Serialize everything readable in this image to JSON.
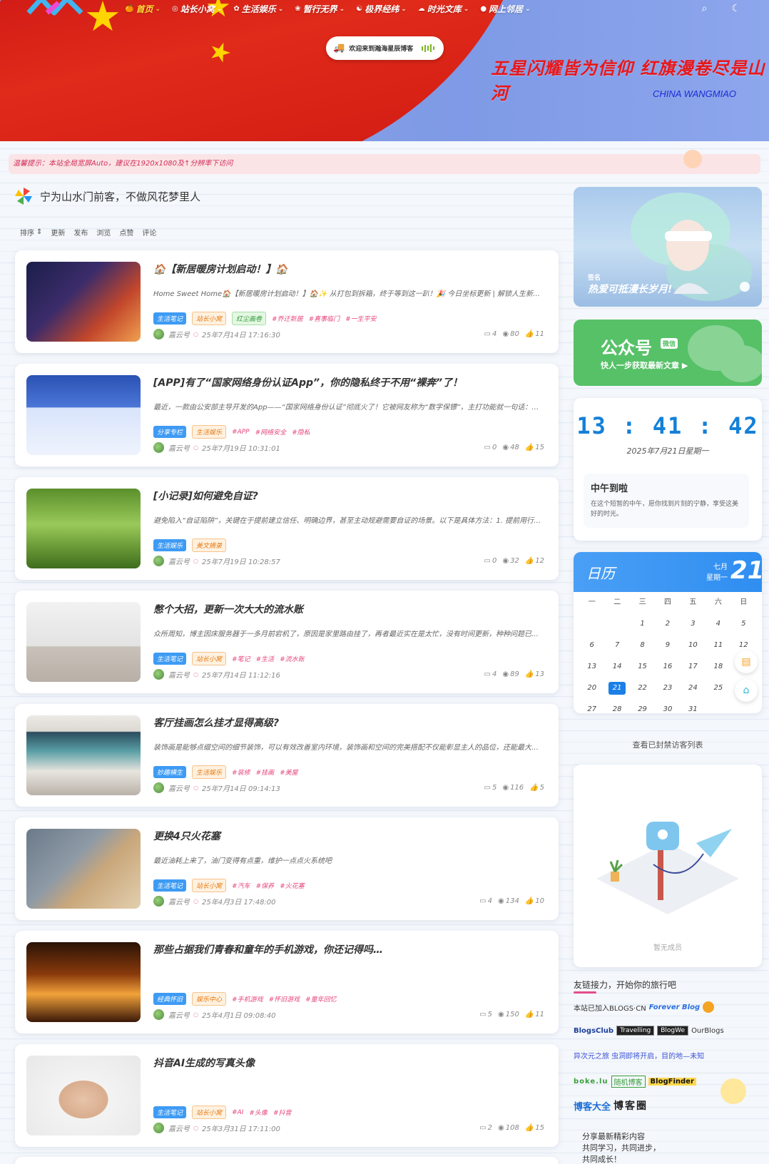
{
  "nav": {
    "items": [
      {
        "icon": "🍊",
        "label": "首页",
        "active": true
      },
      {
        "icon": "◎",
        "label": "站长小窝"
      },
      {
        "icon": "✿",
        "label": "生活娱乐"
      },
      {
        "icon": "❀",
        "label": "暂行无界"
      },
      {
        "icon": "☯",
        "label": "极界经纬"
      },
      {
        "icon": "☁",
        "label": "时光文库"
      },
      {
        "icon": "●",
        "label": "网上邻居"
      }
    ]
  },
  "hero": {
    "welcome": "欢迎来到瀚海星辰博客",
    "slogan": "五星闪耀皆为信仰 红旗漫卷尽是山河",
    "slogan_en": "CHINA WANGMIAO"
  },
  "notice": "温馨提示：本站全局宽屏Auto，建议在1920x1080及↑分辨率下访问",
  "list": {
    "title": "宁为山水门前客，不做风花梦里人",
    "sort_label": "排序",
    "sort_options": [
      "更新",
      "发布",
      "浏览",
      "点赞",
      "评论"
    ]
  },
  "posts": [
    {
      "title": "🏠【新居暖房计划启动！】🏠",
      "excerpt": "Home Sweet Home🏠【新居暖房计划启动！】🏠✨ 从打包到拆箱，终于等到这一趴！🎉 今日坐标更新 | 解锁人生新地图…",
      "tags": [
        {
          "t": "生活笔记",
          "c": "blue"
        },
        {
          "t": "站长小窝",
          "c": "orange"
        },
        {
          "t": "红尘画卷",
          "c": "green"
        },
        {
          "t": "#乔迁新居",
          "c": "hash"
        },
        {
          "t": "#喜事临门",
          "c": "hash"
        },
        {
          "t": "#一生平安",
          "c": "hash"
        }
      ],
      "author": "嘉云号",
      "date": "25年7月14日 17:16:30",
      "comments": "4",
      "views": "80",
      "likes": "11"
    },
    {
      "title": "[APP]有了“国家网络身份认证App”，你的隐私终于不用“裸奔”了！",
      "excerpt": "最近，一款由公安部主导开发的App——“国家网络身份认证”彻底火了！它被网友称为“数字保镖”，主打功能就一句话：让你的身…",
      "tags": [
        {
          "t": "分享专栏",
          "c": "blue"
        },
        {
          "t": "生活娱乐",
          "c": "orange"
        },
        {
          "t": "#APP",
          "c": "hash"
        },
        {
          "t": "#网络安全",
          "c": "hash"
        },
        {
          "t": "#隐私",
          "c": "hash"
        }
      ],
      "author": "嘉云号",
      "date": "25年7月19日 10:31:01",
      "comments": "0",
      "views": "48",
      "likes": "15"
    },
    {
      "title": "[小记录]如何避免自证?",
      "excerpt": "避免陷入“自证陷阱”，关键在于提前建立信任、明确边界，甚至主动规避需要自证的场景。以下是具体方法：1. 提前用行动“筑牢…",
      "tags": [
        {
          "t": "生活娱乐",
          "c": "blue"
        },
        {
          "t": "美文摘录",
          "c": "orange"
        }
      ],
      "author": "嘉云号",
      "date": "25年7月19日 10:28:57",
      "comments": "0",
      "views": "32",
      "likes": "12"
    },
    {
      "title": "憋个大招，更新一次大大的流水账",
      "excerpt": "众所周知，博主因床服务器于一多月前宕机了，原因是家里路由挂了，再者最近实在是太忙，没有时间更新，种种问题已经导致两…",
      "tags": [
        {
          "t": "生活笔记",
          "c": "blue"
        },
        {
          "t": "站长小窝",
          "c": "orange"
        },
        {
          "t": "#笔记",
          "c": "hash"
        },
        {
          "t": "#生活",
          "c": "hash"
        },
        {
          "t": "#流水账",
          "c": "hash"
        }
      ],
      "author": "嘉云号",
      "date": "25年7月14日 11:12:16",
      "comments": "4",
      "views": "89",
      "likes": "13"
    },
    {
      "title": "客厅挂画怎么挂才显得高级?",
      "excerpt": "装饰画是能够点缀空间的细节装饰，可以有效改善室内环境，装饰画和空间的完美搭配不仅能彰显主人的品位，还能最大程度保证…",
      "tags": [
        {
          "t": "妙趣横生",
          "c": "blue"
        },
        {
          "t": "生活娱乐",
          "c": "orange"
        },
        {
          "t": "#装修",
          "c": "hash"
        },
        {
          "t": "#挂画",
          "c": "hash"
        },
        {
          "t": "#美屋",
          "c": "hash"
        }
      ],
      "author": "嘉云号",
      "date": "25年7月14日 09:14:13",
      "comments": "5",
      "views": "116",
      "likes": "5"
    },
    {
      "title": "更换4只火花塞",
      "excerpt": "最近油耗上来了，油门变得有点重，维护一点点火系统吧",
      "tags": [
        {
          "t": "生活笔记",
          "c": "blue"
        },
        {
          "t": "站长小窝",
          "c": "orange"
        },
        {
          "t": "#汽车",
          "c": "hash"
        },
        {
          "t": "#保养",
          "c": "hash"
        },
        {
          "t": "#火花塞",
          "c": "hash"
        }
      ],
      "author": "嘉云号",
      "date": "25年4月3日 17:48:00",
      "comments": "4",
      "views": "134",
      "likes": "10"
    },
    {
      "title": "那些占据我们青春和童年的手机游戏，你还记得吗…",
      "excerpt": "",
      "tags": [
        {
          "t": "经典怀旧",
          "c": "blue"
        },
        {
          "t": "娱乐中心",
          "c": "orange"
        },
        {
          "t": "#手机游戏",
          "c": "hash"
        },
        {
          "t": "#怀旧游戏",
          "c": "hash"
        },
        {
          "t": "#童年回忆",
          "c": "hash"
        }
      ],
      "author": "嘉云号",
      "date": "25年4月1日 09:08:40",
      "comments": "5",
      "views": "150",
      "likes": "11"
    },
    {
      "title": "抖音AI生成的写真头像",
      "excerpt": "",
      "tags": [
        {
          "t": "生活笔记",
          "c": "blue"
        },
        {
          "t": "站长小窝",
          "c": "orange"
        },
        {
          "t": "#AI",
          "c": "hash"
        },
        {
          "t": "#头像",
          "c": "hash"
        },
        {
          "t": "#抖音",
          "c": "hash"
        }
      ],
      "author": "嘉云号",
      "date": "25年3月31日 17:11:00",
      "comments": "2",
      "views": "108",
      "likes": "15"
    }
  ],
  "sidebar": {
    "banner_small": "签名",
    "banner_caption": "热爱可抵漫长岁月!",
    "wechat_title": "公众号",
    "wechat_badge": "微信",
    "wechat_sub": "快人一步获取最新文章 ▶",
    "clock": "13 : 41 : 42",
    "clock_date": "2025年7月21日星期一",
    "greet_title": "中午到啦",
    "greet_text": "在这个短暂的中午，愿你找到片刻的宁静，享受这美好的时光。",
    "cal_title": "日历",
    "cal_month": "七月",
    "cal_weekday": "星期一",
    "cal_day": "21",
    "cal_weekdays": [
      "一",
      "二",
      "三",
      "四",
      "五",
      "六",
      "日"
    ],
    "cal_days": [
      "",
      "",
      "1",
      "2",
      "3",
      "4",
      "5",
      "6",
      "7",
      "8",
      "9",
      "10",
      "11",
      "12",
      "13",
      "14",
      "15",
      "16",
      "17",
      "18",
      "19",
      "20",
      "21",
      "22",
      "23",
      "24",
      "25",
      "26",
      "27",
      "28",
      "29",
      "30",
      "31"
    ],
    "cal_today": "21",
    "visitors_title": "查看已封禁访客列表",
    "empty_text": "暂无成员",
    "links_title": "友链接力，开始你的旅行吧",
    "links": {
      "row1": [
        "本站已加入BLOGS·CN",
        "Forever Blog"
      ],
      "row2": [
        "BlogsClub",
        "Travelling",
        "BlogWe",
        "OurBlogs"
      ],
      "row3": [
        "异次元之旅 虫洞即将开启，目的地—未知"
      ],
      "row4": [
        "boke.lu",
        "随机博客",
        "BlogFinder"
      ],
      "row5": [
        "博客大全",
        "博客圈"
      ]
    },
    "share_lines": [
      "分享最新精彩内容",
      "共同学习，共同进步，",
      "共同成长！"
    ]
  }
}
